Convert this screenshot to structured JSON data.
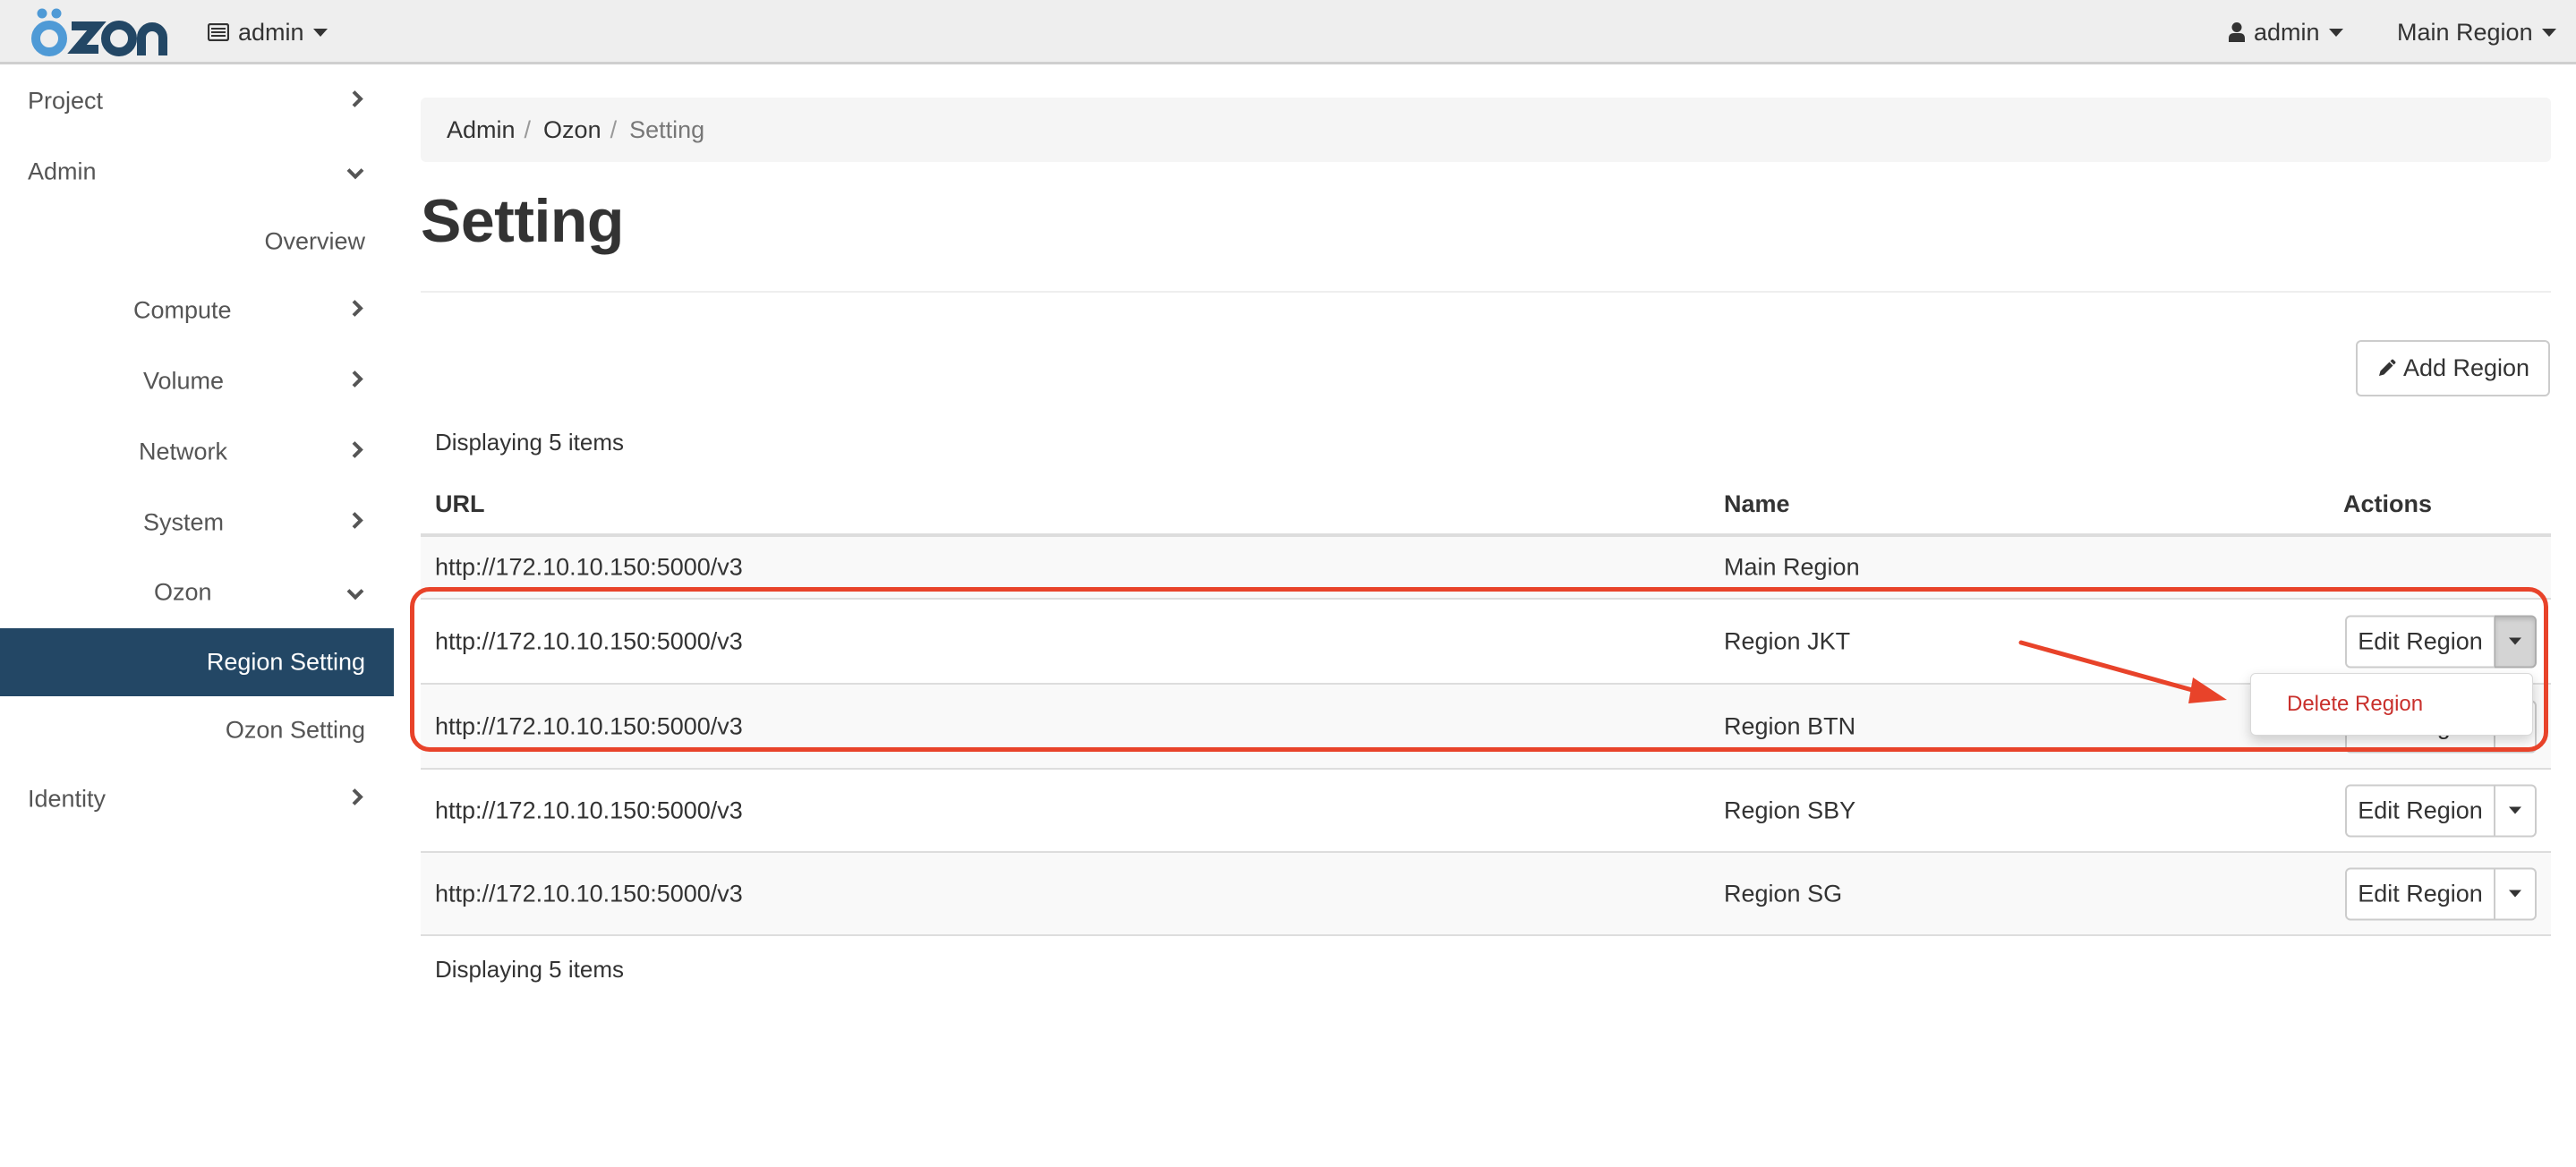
{
  "topbar": {
    "brand": "özon",
    "project_menu": {
      "icon": "list-alt-icon",
      "label": "admin"
    },
    "user_menu": {
      "icon": "user-icon",
      "label": "admin"
    },
    "region_menu": {
      "label": "Main Region"
    }
  },
  "sidebar": {
    "items": [
      {
        "label": "Project",
        "chevron": "right"
      },
      {
        "label": "Admin",
        "chevron": "down"
      },
      {
        "label": "Overview",
        "chevron": ""
      },
      {
        "label": "Compute",
        "chevron": "right"
      },
      {
        "label": "Volume",
        "chevron": "right"
      },
      {
        "label": "Network",
        "chevron": "right"
      },
      {
        "label": "System",
        "chevron": "right"
      },
      {
        "label": "Ozon",
        "chevron": "down"
      },
      {
        "label": "Region Setting",
        "chevron": "",
        "active": true
      },
      {
        "label": "Ozon Setting",
        "chevron": ""
      },
      {
        "label": "Identity",
        "chevron": "right"
      }
    ]
  },
  "breadcrumb": {
    "items": [
      "Admin",
      "Ozon",
      "Setting"
    ],
    "separator": "/"
  },
  "page": {
    "title": "Setting",
    "add_button": "Add Region",
    "count_top": "Displaying 5 items",
    "count_bottom": "Displaying 5 items"
  },
  "table": {
    "columns": [
      "URL",
      "Name",
      "Actions"
    ],
    "rows": [
      {
        "url": "http://172.10.10.150:5000/v3",
        "name": "Main Region",
        "action": ""
      },
      {
        "url": "http://172.10.10.150:5000/v3",
        "name": "Region JKT",
        "action": "Edit Region",
        "dropdown_open": true
      },
      {
        "url": "http://172.10.10.150:5000/v3",
        "name": "Region BTN",
        "action": "Edit Region"
      },
      {
        "url": "http://172.10.10.150:5000/v3",
        "name": "Region SBY",
        "action": "Edit Region"
      },
      {
        "url": "http://172.10.10.150:5000/v3",
        "name": "Region SG",
        "action": "Edit Region"
      }
    ]
  },
  "dropdown": {
    "items": [
      "Delete Region"
    ]
  },
  "colors": {
    "brand_light": "#4f9ad6",
    "brand_dark": "#234765",
    "active_bg": "#234765",
    "danger": "#c9302c",
    "annotation": "#e8432a"
  }
}
